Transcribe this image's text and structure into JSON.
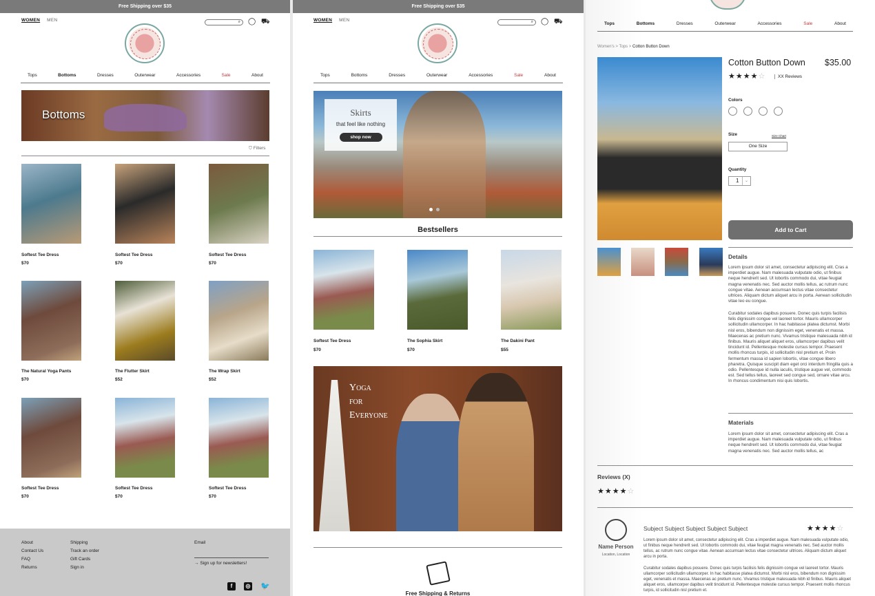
{
  "banner": "Free Shipping over $35",
  "gender_nav": [
    "WOMEN",
    "MEN"
  ],
  "categories": [
    "Tops",
    "Bottoms",
    "Dresses",
    "Outerwear",
    "Accessories",
    "Sale",
    "About"
  ],
  "p1": {
    "hero_title": "Bottoms",
    "filters": "Filters",
    "products": [
      {
        "name": "Softest Tee Dress",
        "price": "$70"
      },
      {
        "name": "Softest Tee Dress",
        "price": "$70"
      },
      {
        "name": "Softest Tee Dress",
        "price": "$70"
      },
      {
        "name": "The Natural Yoga Pants",
        "price": "$70"
      },
      {
        "name": "The Flutter Skirt",
        "price": "$52"
      },
      {
        "name": "The Wrap Skirt",
        "price": "$52"
      },
      {
        "name": "Softest Tee Dress",
        "price": "$70"
      },
      {
        "name": "Softest Tee Dress",
        "price": "$70"
      },
      {
        "name": "Softest Tee Dress",
        "price": "$70"
      }
    ],
    "footer": {
      "col1": [
        "About",
        "Contact Us",
        "FAQ",
        "Returns"
      ],
      "col2": [
        "Shipping",
        "Track an order",
        "Gift Cards",
        "Sign in"
      ],
      "email_label": "Email",
      "newsletter": "Sign up for newsletters!"
    }
  },
  "p2": {
    "hero_title": "Skirts",
    "hero_sub": "that feel like nothing",
    "hero_btn": "shop now",
    "bestsellers": "Bestsellers",
    "products": [
      {
        "name": "Softest Tee Dress",
        "price": "$70"
      },
      {
        "name": "The Sophia Skirt",
        "price": "$70"
      },
      {
        "name": "The Dakini Pant",
        "price": "$55"
      }
    ],
    "yoga": [
      "Yoga",
      "for",
      "Everyone"
    ],
    "shipping": "Free Shipping & Returns"
  },
  "p3": {
    "breadcrumb": {
      "a": "Women's",
      "b": "Tops",
      "c": "Cotton Button Down"
    },
    "title": "Cotton Button Down",
    "price": "$35.00",
    "reviews_link": "XX Reviews",
    "colors_label": "Colors",
    "size_label": "Size",
    "size_chart": "Size Chart",
    "size_value": "One Size",
    "qty_label": "Quantity",
    "qty_value": "1",
    "add_to_cart": "Add to Cart",
    "details_label": "Details",
    "details_p1": "Lorem ipsum dolor sit amet, consectetur adipiscing elit. Cras a imperdiet augue. Nam malesuada vulputate odio, ut finibus neque hendrerit sed. Ut lobortis commodo dui, vitae feugiat magna venenatis nec. Sed auctor mollis tellus, ac rutrum nunc congue vitae. Aenean accumsan lectus vitae consectetur ultrices. Aliquam dictum aliquet arcu in porta. Aenean sollicitudin vitae leo eu congue.",
    "details_p2": "Curabitur sodales dapibus posuere. Donec quis turpis facilisis felis dignissim congue vel laoreet tortor. Mauris ullamcorper sollicitudin ullamcorper. In hac habitasse platea dictumst. Morbi nisl eros, bibendum non dignissim eget, venenatis et massa. Maecenas ac pretium nunc. Vivamus tristique malesuada nibh id finibus. Mauris aliquet aliquet eros, ullamcorper dapibus velit tincidunt id. Pellentesque molestie cursus tempor. Praesent mollis rhoncus turpis, id sollicitudin nisl pretium et. Proin fermentum massa id sapien lobortis, vitae congue libero pharetra. Quisque suscipit diam eget orci interdum fringilla quis a odio. Pellentesque id nulla iaculis, tristique augue vel, commodo est. Sed tellus tellus, laoreet sed congue sed, ornare vitae arcu. In rhoncus condimentum nisi quis lobortis.",
    "materials_label": "Materials",
    "materials": "Lorem ipsum dolor sit amet, consectetur adipiscing elit. Cras a imperdiet augue. Nam malesuada vulputate odio, ut finibus neque hendrerit sed. Ut lobortis commodo dui, vitae feugiat magna venenatis nec. Sed auctor mollis tellus, ac",
    "reviews_title": "Reviews (X)",
    "reviewer": "Name Person",
    "reviewer_loc": "Location, Location",
    "review_subject": "Subject Subject Subject Subject Subject",
    "review_p1": "Lorem ipsum dolor sit amet, consectetur adipiscing elit. Cras a imperdiet augue. Nam malesuada vulputate odio, ut finibus neque hendrerit sed. Ut lobortis commodo dui, vitae feugiat magna venenatis nec. Sed auctor mollis tellus, ac rutrum nunc congue vitae. Aenean accumsan lectus vitae consectetur ultrices. Aliquam dictum aliquet arcu in porta.",
    "review_p2": "Curabitur sodales dapibus posuere. Donec quis turpis facilisis felis dignissim congue vel laoreet tortor. Mauris ullamcorper sollicitudin ullamcorper. In hac habitasse platea dictumst. Morbi nisl eros, bibendum non dignissim eget, venenatis et massa. Maecenas ac pretium nunc. Vivamus tristique malesuada nibh id finibus. Mauris aliquet aliquet eros, ullamcorper dapibus velit tincidunt id. Pellentesque molestie cursus tempor. Praesent mollis rhoncus turpis, id sollicitudin nisl pretium et."
  },
  "colors": {
    "sale": "#c0393b",
    "banner": "#7a7a7a",
    "footer": "#c9c9c9",
    "button": "#6f6f6f"
  }
}
